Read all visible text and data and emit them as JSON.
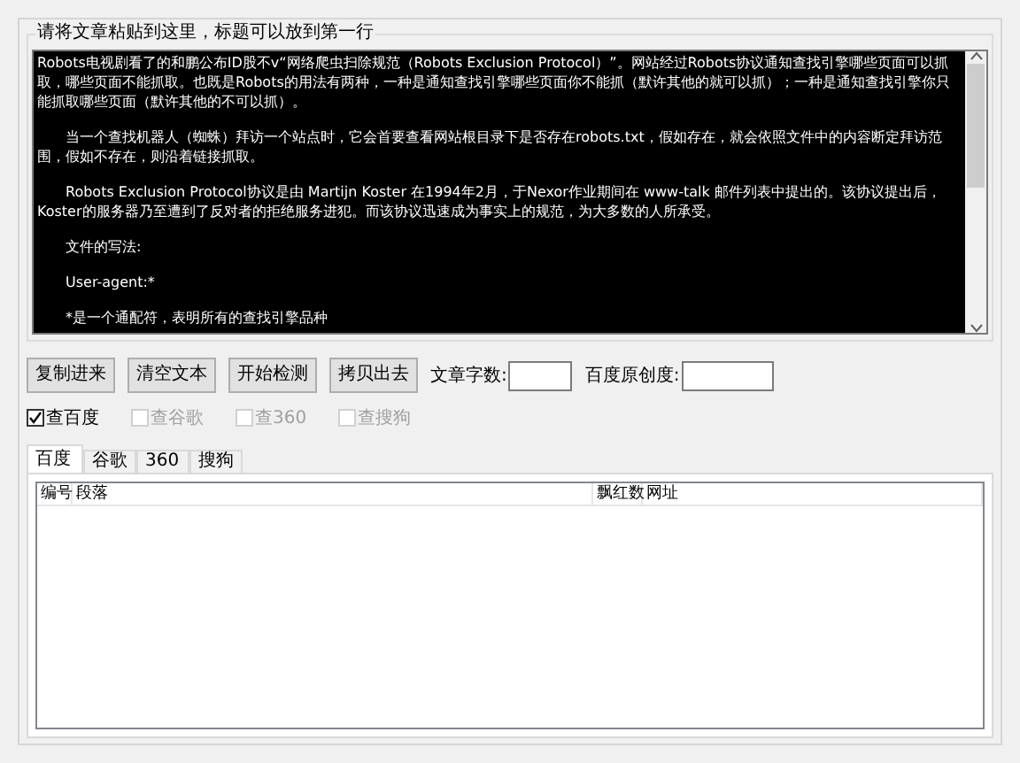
{
  "input_group": {
    "title": "请将文章粘贴到这里，标题可以放到第一行"
  },
  "paragraphs": [
    {
      "text": "Robots电视剧看了的和鹏公布ID股不v“网络爬虫扫除规范（Robots Exclusion Protocol）”。网站经过Robots协议通知查找引擎哪些页面可以抓取，哪些页面不能抓取。也既是Robots的用法有两种，一种是通知查找引擎哪些页面你不能抓（默许其他的就可以抓）；一种是通知查找引擎你只能抓取哪些页面（默许其他的不可以抓）。",
      "indented": false
    },
    {
      "text": "当一个查找机器人（蜘蛛）拜访一个站点时，它会首要查看网站根目录下是否存在robots.txt，假如存在，就会依照文件中的内容断定拜访范围，假如不存在，则沿着链接抓取。",
      "indented": true
    },
    {
      "text": "Robots Exclusion Protocol协议是由 Martijn Koster 在1994年2月，于Nexor作业期间在 www-talk 邮件列表中提出的。该协议提出后，Koster的服务器乃至遭到了反对者的拒绝服务进犯。而该协议迅速成为事实上的规范，为大多数的人所承受。",
      "indented": true
    },
    {
      "text": "文件的写法:",
      "indented": true
    },
    {
      "text": "User-agent:*",
      "indented": true
    },
    {
      "text": "*是一个通配符，表明所有的查找引擎品种",
      "indented": true
    }
  ],
  "buttons": [
    "复制进来",
    "清空文本",
    "开始检测",
    "拷贝出去"
  ],
  "fields": [
    {
      "label": "文章字数:"
    },
    {
      "label": "百度原创度:"
    }
  ],
  "checkboxes": [
    {
      "label": "查百度",
      "checked": true,
      "disabled": false
    },
    {
      "label": "查谷歌",
      "checked": false,
      "disabled": true
    },
    {
      "label": "查360",
      "checked": false,
      "disabled": true
    },
    {
      "label": "查搜狗",
      "checked": false,
      "disabled": true
    }
  ],
  "tabs": [
    {
      "label": "百度",
      "selected": true
    },
    {
      "label": "谷歌",
      "selected": false
    },
    {
      "label": "360",
      "selected": false
    },
    {
      "label": "搜狗",
      "selected": false
    }
  ],
  "table": {
    "columns": [
      "编号",
      "段落",
      "飘红数",
      "网址"
    ]
  }
}
